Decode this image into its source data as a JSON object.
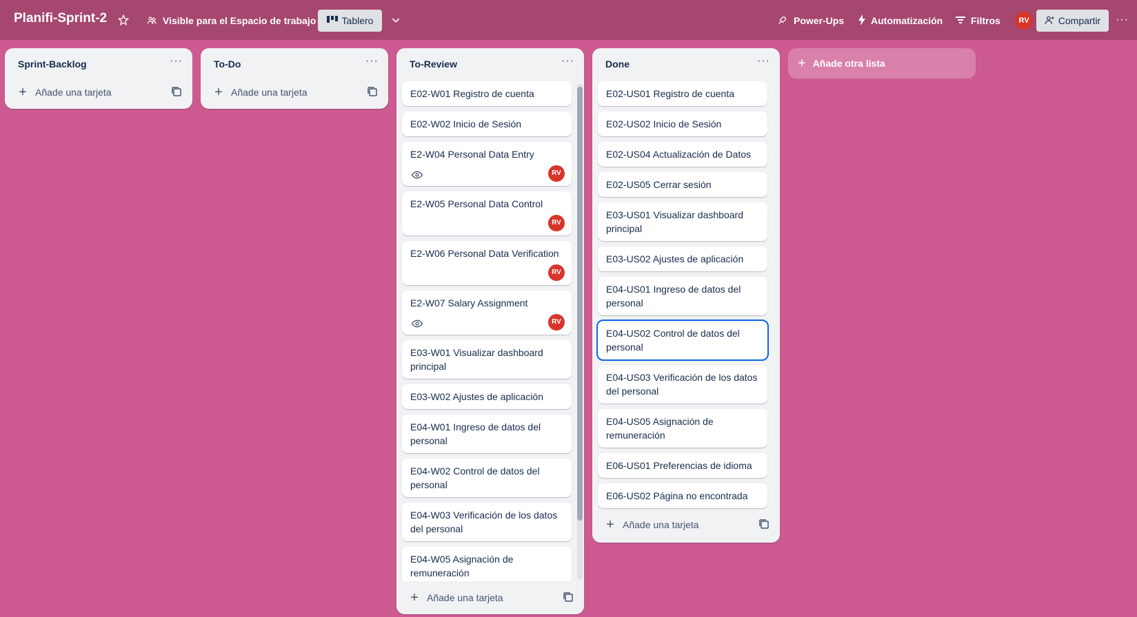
{
  "header": {
    "board_title": "Planifi-Sprint-2",
    "visibility_label": "Visible para el Espacio de trabajo",
    "view_label": "Tablero",
    "powerups_label": "Power-Ups",
    "automation_label": "Automatización",
    "filters_label": "Filtros",
    "avatar_initials": "RV",
    "share_label": "Compartir",
    "more_label": "···"
  },
  "lists": [
    {
      "title": "Sprint-Backlog",
      "add_card_label": "Añade una tarjeta",
      "cards": []
    },
    {
      "title": "To-Do",
      "add_card_label": "Añade una tarjeta",
      "cards": []
    },
    {
      "title": "To-Review",
      "add_card_label": "Añade una tarjeta",
      "cards": [
        {
          "title": "E02-W01 Registro de cuenta"
        },
        {
          "title": "E02-W02 Inicio de Sesión"
        },
        {
          "title": "E2-W04 Personal Data Entry",
          "watched": true,
          "member": "RV"
        },
        {
          "title": "E2-W05 Personal Data Control",
          "member": "RV"
        },
        {
          "title": "E2-W06 Personal Data Verification",
          "member": "RV"
        },
        {
          "title": "E2-W07 Salary Assignment",
          "watched": true,
          "member": "RV"
        },
        {
          "title": "E03-W01 Visualizar dashboard principal"
        },
        {
          "title": "E03-W02 Ajustes de aplicación"
        },
        {
          "title": "E04-W01 Ingreso de datos del personal"
        },
        {
          "title": "E04-W02 Control de datos del personal"
        },
        {
          "title": "E04-W03 Verificación de los datos del personal"
        },
        {
          "title": "E04-W05 Asignación de remuneración"
        }
      ]
    },
    {
      "title": "Done",
      "add_card_label": "Añade una tarjeta",
      "cards": [
        {
          "title": "E02-US01 Registro de cuenta"
        },
        {
          "title": "E02-US02 Inicio de Sesión"
        },
        {
          "title": "E02-US04 Actualización de Datos"
        },
        {
          "title": "E02-US05 Cerrar sesión"
        },
        {
          "title": "E03-US01 Visualizar dashboard principal"
        },
        {
          "title": "E03-US02 Ajustes de aplicación"
        },
        {
          "title": "E04-US01 Ingreso de datos del personal"
        },
        {
          "title": "E04-US02 Control de datos del personal",
          "focused": true
        },
        {
          "title": "E04-US03 Verificación de los datos del personal"
        },
        {
          "title": "E04-US05 Asignación de remuneración"
        },
        {
          "title": "E06-US01 Preferencias de idioma"
        },
        {
          "title": "E06-US02 Página no encontrada"
        }
      ]
    }
  ],
  "add_list_label": "Añade otra lista",
  "list_menu_label": "···",
  "colors": {
    "board_background": "#cd5a91",
    "header_background": "#a5476f",
    "avatar": "#d7352a",
    "focus_ring": "#0c66e4"
  }
}
